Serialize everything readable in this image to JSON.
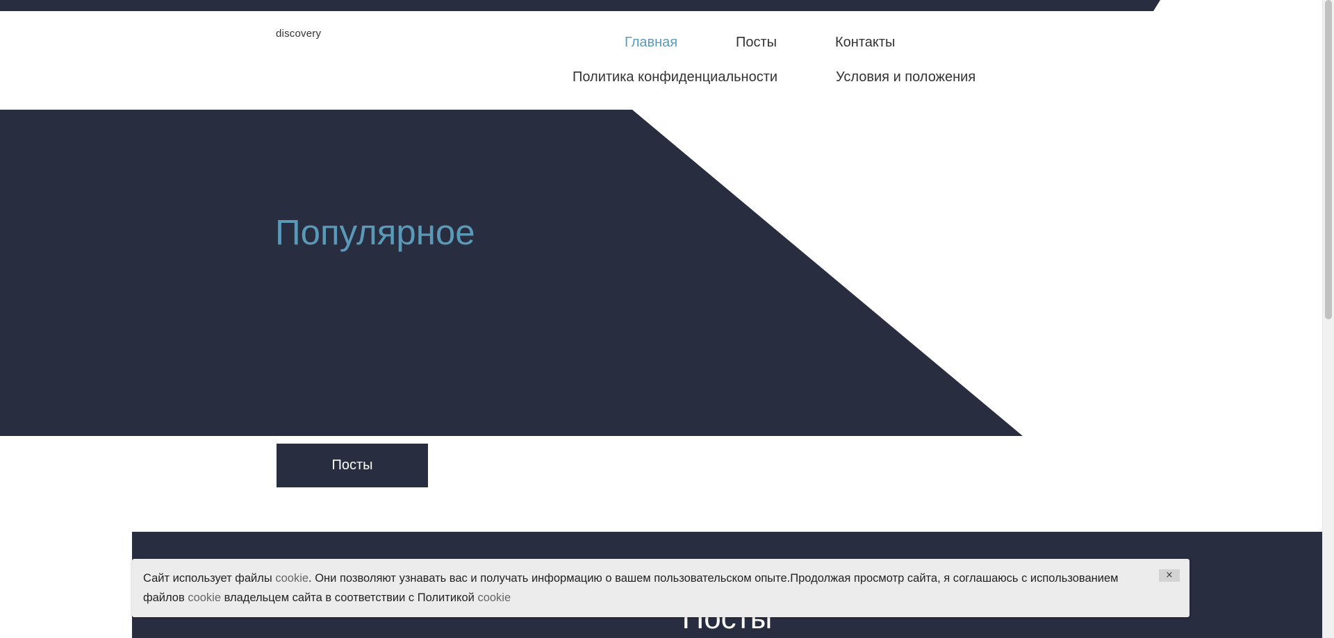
{
  "header": {
    "logo_text": "discovery",
    "nav": {
      "home": "Главная",
      "posts": "Посты",
      "contacts": "Контакты",
      "privacy": "Политика конфиденциальности",
      "terms": "Условия и положения"
    },
    "active_item": "home"
  },
  "hero": {
    "title": "Популярное",
    "button_label": "Посты"
  },
  "posts_section": {
    "heading": "Посты"
  },
  "cookie_banner": {
    "text_1": "Сайт использует файлы ",
    "kw_1": "cookie",
    "text_2": ". Они позволяют узнавать вас и получать информацию о вашем пользовательском опыте.Продолжая просмотр сайта, я соглашаюсь с использованием файлов ",
    "kw_2": "cookie",
    "text_3": " владельцем сайта в соответствии с Политикой ",
    "kw_3": "cookie",
    "close_label": "×"
  },
  "colors": {
    "dark": "#292d40",
    "accent": "#5a9ab8",
    "banner_bg": "#ececec"
  }
}
